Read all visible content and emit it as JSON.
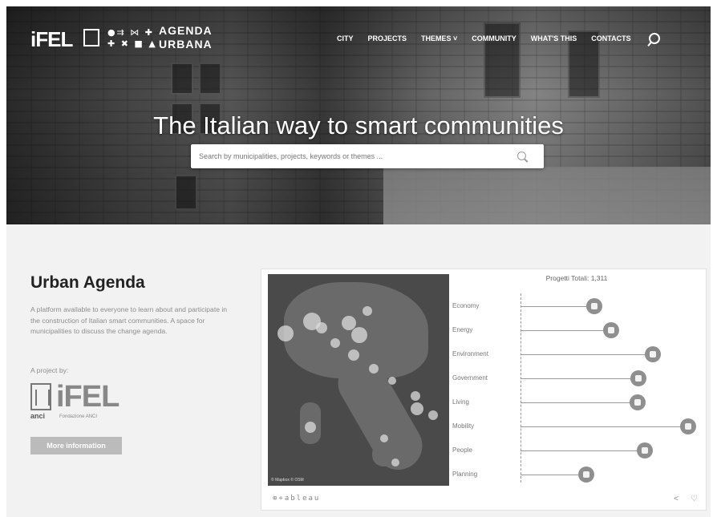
{
  "header": {
    "logo_text": "iFEL",
    "agenda_line1": "AGENDA",
    "agenda_line2": "URBANA",
    "glyph_line1": "●⇉ ⋈ ✚",
    "glyph_line2": "✚ ✖ ■ ▲",
    "nav": [
      "CITY",
      "PROJECTS",
      "THEMES ˅",
      "COMMUNITY",
      "WHAT'S THIS",
      "CONTACTS"
    ]
  },
  "hero": {
    "title": "The Italian way to smart communities",
    "search_placeholder": "Search by municipalities, projects, keywords or themes ..."
  },
  "intro": {
    "title": "Urban Agenda",
    "description": "A platform available to everyone to learn about and participate in the construction of Italian smart communities. A space for municipalities to discuss the change agenda.",
    "project_by": "A project by:",
    "partner_anci": "anci",
    "partner_ifel": "iFEL",
    "partner_fondazione": "Fondazione ANCI",
    "more_button": "More information"
  },
  "embed": {
    "map_copyright": "© Mapbox  © OSM",
    "footer_logo": "⊕+ableau",
    "share_icon_glyph": "<",
    "comment_icon_glyph": "♡"
  },
  "chart_data": {
    "type": "lollipop",
    "title": "Progetti Totali: 1,311",
    "categories": [
      "Economy",
      "Energy",
      "Environment",
      "Government",
      "Living",
      "Mobility",
      "People",
      "Planning"
    ],
    "values": [
      65,
      80,
      117,
      104,
      103,
      148,
      110,
      58
    ],
    "xlim": [
      0,
      150
    ],
    "grid": false
  }
}
